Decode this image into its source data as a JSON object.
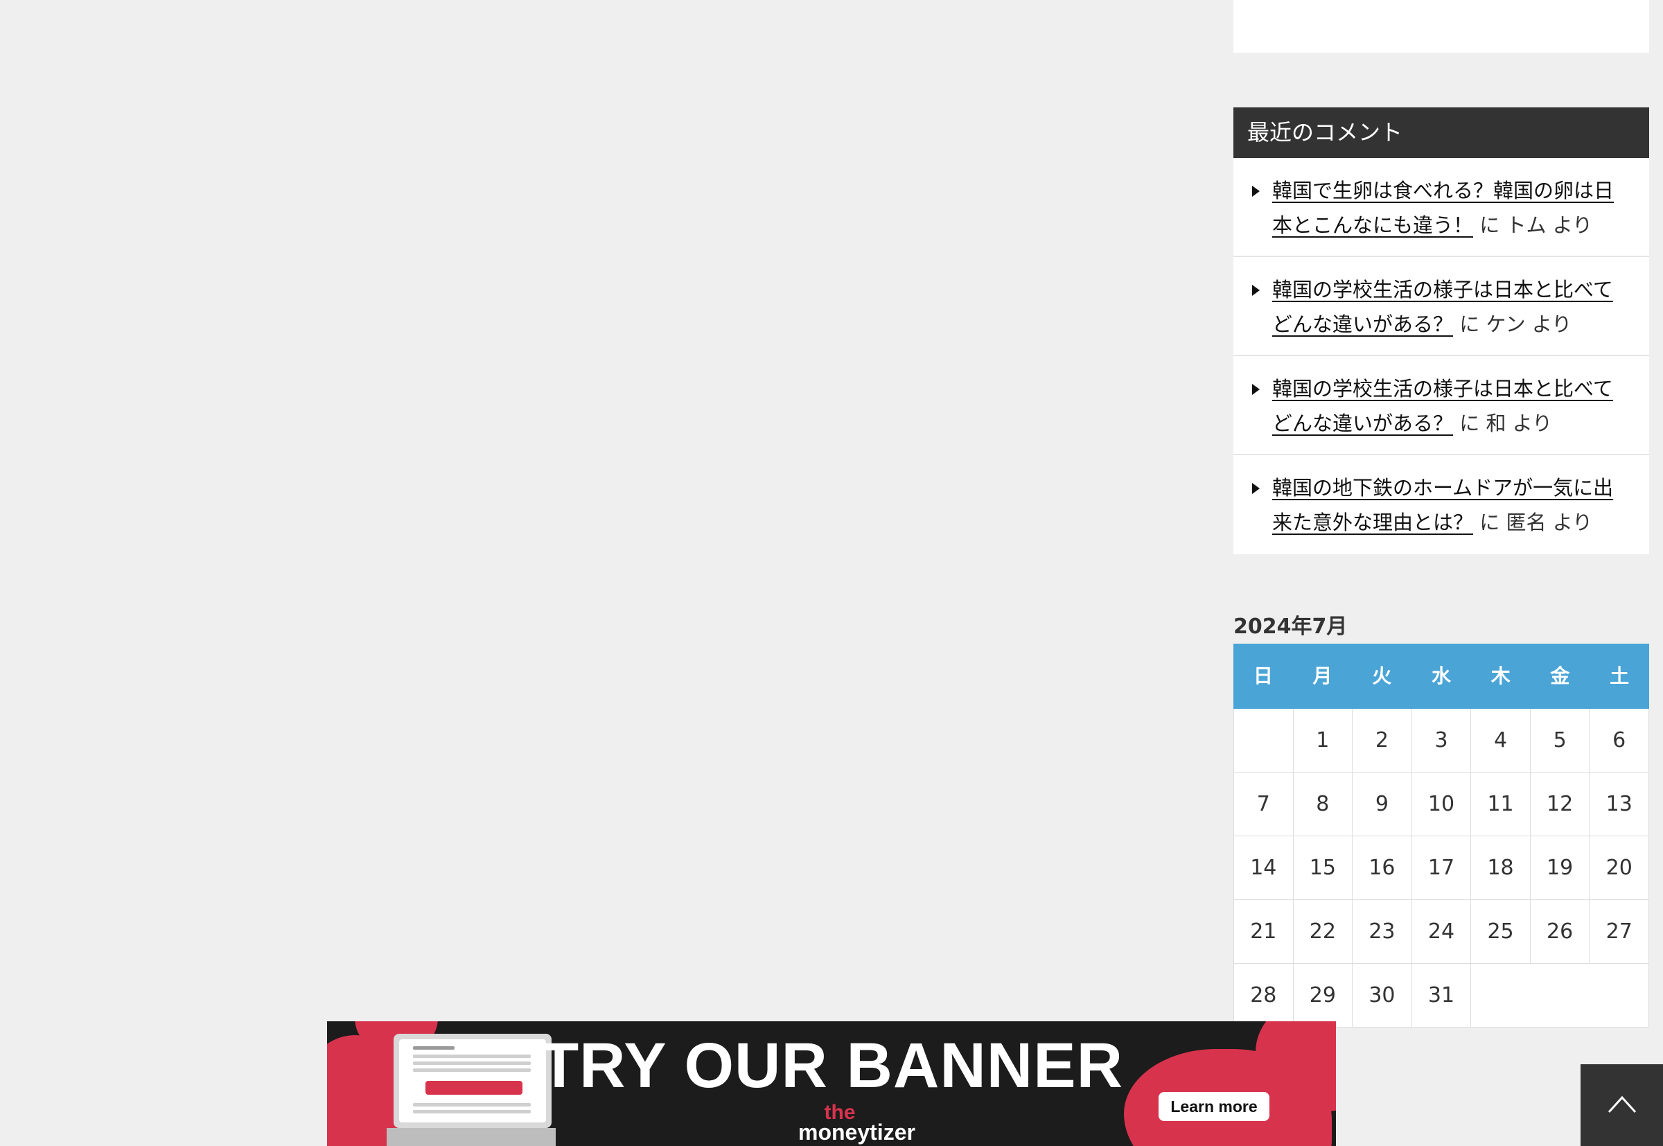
{
  "recent_comments": {
    "title": "最近のコメント",
    "items": [
      {
        "post": "韓国で生卵は食べれる？韓国の卵は日本とこんなにも違う！",
        "connector": "に",
        "author": "トム",
        "suffix": "より"
      },
      {
        "post": "韓国の学校生活の様子は日本と比べてどんな違いがある？",
        "connector": "に",
        "author": "ケン",
        "suffix": "より"
      },
      {
        "post": "韓国の学校生活の様子は日本と比べてどんな違いがある？",
        "connector": "に",
        "author": "和",
        "suffix": "より"
      },
      {
        "post": "韓国の地下鉄のホームドアが一気に出来た意外な理由とは？",
        "connector": "に",
        "author": "匿名",
        "suffix": "より"
      }
    ]
  },
  "calendar": {
    "caption": "2024年7月",
    "weekdays": [
      "日",
      "月",
      "火",
      "水",
      "木",
      "金",
      "土"
    ],
    "weeks": [
      [
        "",
        "1",
        "2",
        "3",
        "4",
        "5",
        "6"
      ],
      [
        "7",
        "8",
        "9",
        "10",
        "11",
        "12",
        "13"
      ],
      [
        "14",
        "15",
        "16",
        "17",
        "18",
        "19",
        "20"
      ],
      [
        "21",
        "22",
        "23",
        "24",
        "25",
        "26",
        "27"
      ],
      [
        "28",
        "29",
        "30",
        "31",
        null,
        null,
        null
      ]
    ]
  },
  "banner": {
    "headline": "TRY OUR BANNER",
    "brand_top": "the",
    "brand_bottom": "moneytizer",
    "cta": "Learn more"
  },
  "back_to_top": {
    "icon": "chevron-up-icon"
  },
  "colors": {
    "page_bg": "#efefef",
    "widget_title_bg": "#333333",
    "calendar_head_bg": "#4aa4d6",
    "banner_bg": "#1c1c1c",
    "banner_accent": "#d8334d"
  }
}
